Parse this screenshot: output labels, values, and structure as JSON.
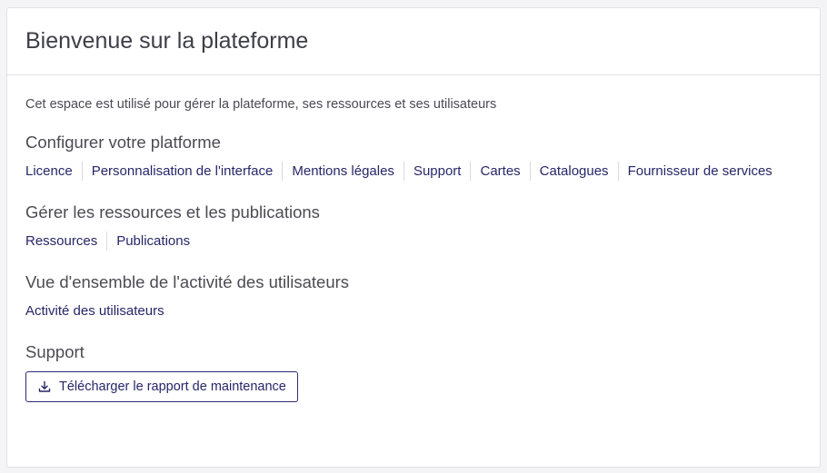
{
  "header": {
    "title": "Bienvenue sur la plateforme"
  },
  "intro": "Cet espace est utilisé pour gérer la plateforme, ses ressources et ses utilisateurs",
  "sections": {
    "configure": {
      "title": "Configurer votre platforme",
      "links": [
        "Licence",
        "Personnalisation de l'interface",
        "Mentions légales",
        "Support",
        "Cartes",
        "Catalogues",
        "Fournisseur de services"
      ]
    },
    "resources": {
      "title": "Gérer les ressources et les publications",
      "links": [
        "Ressources",
        "Publications"
      ]
    },
    "activity": {
      "title": "Vue d'ensemble de l'activité des utilisateurs",
      "links": [
        "Activité des utilisateurs"
      ]
    },
    "support": {
      "title": "Support",
      "button_label": "Télécharger le rapport de maintenance",
      "button_icon": "download-icon"
    }
  },
  "colors": {
    "link": "#262669",
    "button_border": "#2b2b78",
    "background": "#f4f4f6",
    "card": "#ffffff"
  }
}
